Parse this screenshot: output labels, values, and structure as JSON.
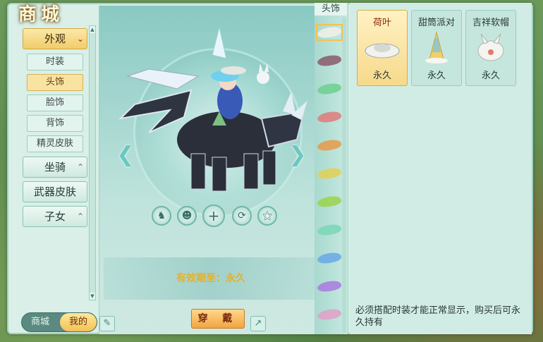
{
  "title": "商城",
  "sidebar": {
    "categories": [
      {
        "label": "外观",
        "expanded": true
      },
      {
        "label": "坐骑",
        "expanded": false
      },
      {
        "label": "武器皮肤",
        "expanded": false
      },
      {
        "label": "子女",
        "expanded": false
      }
    ],
    "subitems": [
      "时装",
      "头饰",
      "脸饰",
      "背饰",
      "精灵皮肤"
    ],
    "selected_subitem": "头饰"
  },
  "mode_toggle": {
    "shop": "商城",
    "mine": "我的",
    "active": "我的"
  },
  "preview": {
    "validity_label": "有效期至：永久",
    "wear_button": "穿 戴",
    "icons": [
      "person-icon",
      "character-icon",
      "plus-icon",
      "rotate-icon",
      "pose-icon"
    ]
  },
  "color_column": {
    "header": "头饰",
    "swatches": [
      "#f4f0e6",
      "#8a5a6a",
      "#6fcf8f",
      "#e07a7a",
      "#e69a48",
      "#e2d052",
      "#9ad34a",
      "#7ad6b6",
      "#6aa8e8",
      "#a87ae0",
      "#e2a0c8"
    ]
  },
  "items": [
    {
      "name": "荷叶",
      "duration": "永久",
      "selected": true
    },
    {
      "name": "甜筒派对",
      "duration": "永久",
      "selected": false
    },
    {
      "name": "吉祥软帽",
      "duration": "永久",
      "selected": false
    }
  ],
  "note": "必须搭配时装才能正常显示，购买后可永久持有"
}
